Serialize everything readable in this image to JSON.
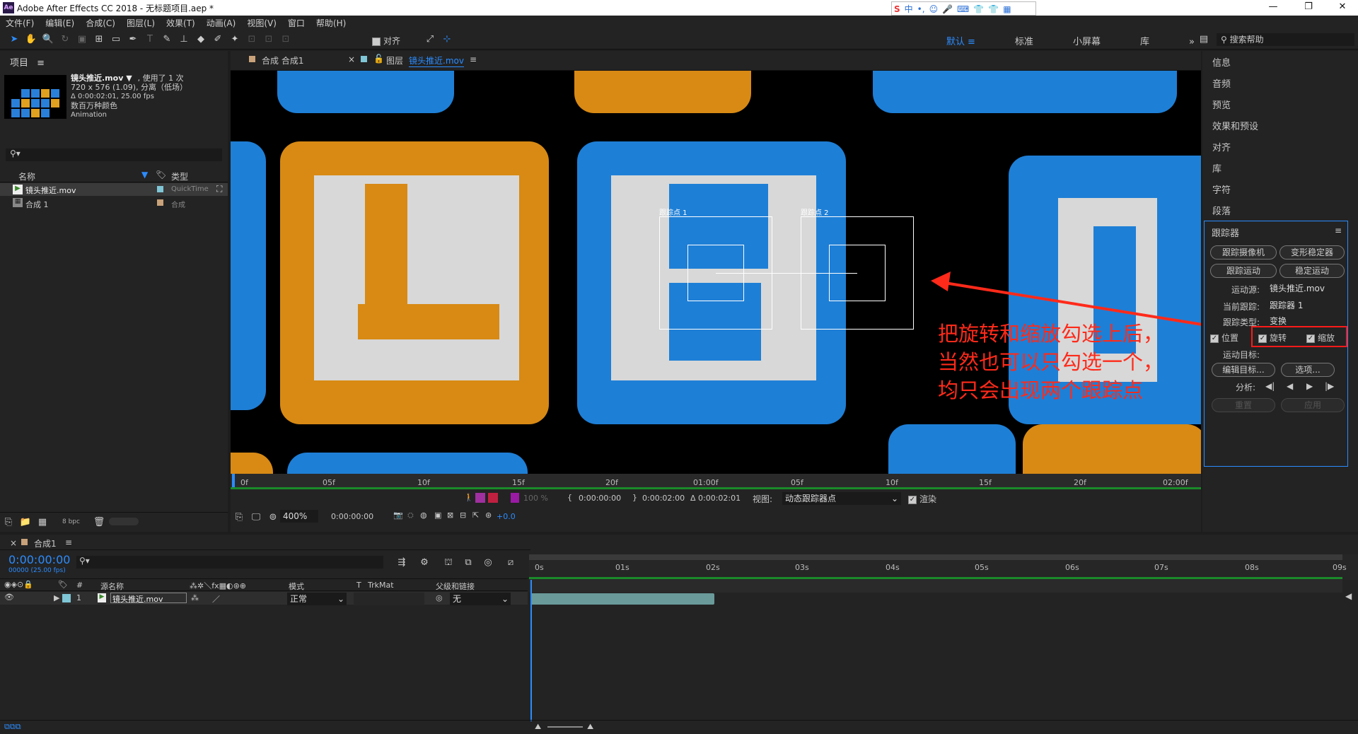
{
  "window": {
    "title": "Adobe After Effects CC 2018 - 无标题项目.aep *",
    "logo": "Ae",
    "min": "—",
    "max": "❐",
    "close": "✕"
  },
  "ime": {
    "items": [
      "S",
      "中",
      "•,",
      "☺",
      "🎤",
      "⌨",
      "👕",
      "👕",
      "▦"
    ]
  },
  "menu": [
    "文件(F)",
    "编辑(E)",
    "合成(C)",
    "图层(L)",
    "效果(T)",
    "动画(A)",
    "视图(V)",
    "窗口",
    "帮助(H)"
  ],
  "toolbar": {
    "align_label": "对齐",
    "workspaces": [
      "默认",
      "≡",
      "标准",
      "小屏幕",
      "库"
    ],
    "more": "»",
    "search_placeholder": "搜索帮助"
  },
  "project": {
    "tab": "项目",
    "menu": "≡",
    "item_name": "镜头推近.mov ▼",
    "used": ", 使用了 1 次",
    "info1": "720 x 576 (1.09), 分离（低场）",
    "info2": "Δ 0:00:02:01, 25.00 fps",
    "info3": "数百万种颜色",
    "info4": "Animation",
    "col_name": "名称",
    "col_type": "类型",
    "rows": [
      {
        "name": "镜头推近.mov",
        "type": "QuickTime"
      },
      {
        "name": "合成 1",
        "type": "合成"
      }
    ],
    "bpc": "8 bpc"
  },
  "viewer": {
    "tab1": "合成 合成1",
    "tab2_prefix": "图层",
    "tab2_name": "镜头推近.mov",
    "tab2_menu": "≡",
    "track1": "跟踪点 1",
    "track2": "跟踪点 2",
    "annotation": [
      "把旋转和缩放勾选上后，",
      "当然也可以只勾选一个，",
      "均只会出现两个跟踪点"
    ],
    "ruler": [
      "0f",
      "05f",
      "10f",
      "15f",
      "20f",
      "01:00f",
      "05f",
      "10f",
      "15f",
      "20f",
      "02:00f"
    ],
    "time_in": "0:00:00:00",
    "time_out": "0:00:02:00",
    "duration": "Δ 0:00:02:01",
    "view_label": "视图:",
    "view_value": "动态跟踪器点",
    "render_label": "渲染",
    "pct": "100 %",
    "zoom": "400%",
    "time_cur": "0:00:00:00",
    "offset": "+0.0"
  },
  "right": {
    "items": [
      "信息",
      "音频",
      "预览",
      "效果和预设",
      "对齐",
      "库",
      "字符",
      "段落"
    ],
    "tracker": "跟踪器",
    "btn_track_camera": "跟踪摄像机",
    "btn_warp": "变形稳定器",
    "btn_track_motion": "跟踪运动",
    "btn_stabilize": "稳定运动",
    "motion_source_label": "运动源:",
    "motion_source": "镜头推近.mov",
    "current_track_label": "当前跟踪:",
    "current_track": "跟踪器 1",
    "track_type_label": "跟踪类型:",
    "track_type": "变换",
    "position": "位置",
    "rotation": "旋转",
    "scale": "缩放",
    "motion_target": "运动目标:",
    "edit_target": "编辑目标...",
    "options": "选项...",
    "analyze": "分析:",
    "reset": "重置",
    "apply": "应用"
  },
  "timeline": {
    "tab": "合成1",
    "menu": "≡",
    "timecode": "0:00:00:00",
    "frames": "00000 (25.00 fps)",
    "col_num": "#",
    "col_source": "源名称",
    "col_mode": "模式",
    "col_t": "T",
    "col_trkmat": "TrkMat",
    "col_parent": "父级和链接",
    "layer_num": "1",
    "layer_name": "镜头推近.mov",
    "layer_mode": "正常",
    "layer_parent": "无",
    "ruler": [
      "0s",
      "01s",
      "02s",
      "03s",
      "04s",
      "05s",
      "06s",
      "07s",
      "08s",
      "09s"
    ]
  },
  "colors": {
    "accent": "#2b8cff",
    "annotation": "#ff2a1a",
    "highlight": "#ff1a1a"
  }
}
